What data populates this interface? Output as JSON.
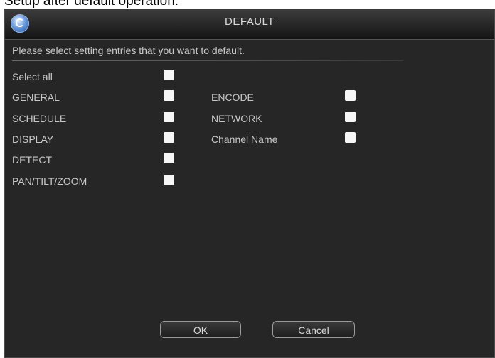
{
  "page_caption": "Setup after default operation.",
  "dialog": {
    "title": "DEFAULT",
    "prompt": "Please select setting entries that you want to default.",
    "select_all_label": "Select all",
    "left_items": [
      {
        "label": "GENERAL",
        "checked": true
      },
      {
        "label": "SCHEDULE",
        "checked": true
      },
      {
        "label": "DISPLAY",
        "checked": true
      },
      {
        "label": "DETECT",
        "checked": true
      },
      {
        "label": "PAN/TILT/ZOOM",
        "checked": true
      }
    ],
    "right_items": [
      {
        "label": "ENCODE",
        "checked": true
      },
      {
        "label": "NETWORK",
        "checked": true
      },
      {
        "label": "Channel Name",
        "checked": true
      }
    ],
    "ok_label": "OK",
    "cancel_label": "Cancel"
  },
  "colors": {
    "dialog_bg": "#262626",
    "text": "#c8c8c8",
    "checkbox": "#f6f6f6"
  },
  "icons": {
    "logo": "app-logo-icon"
  }
}
